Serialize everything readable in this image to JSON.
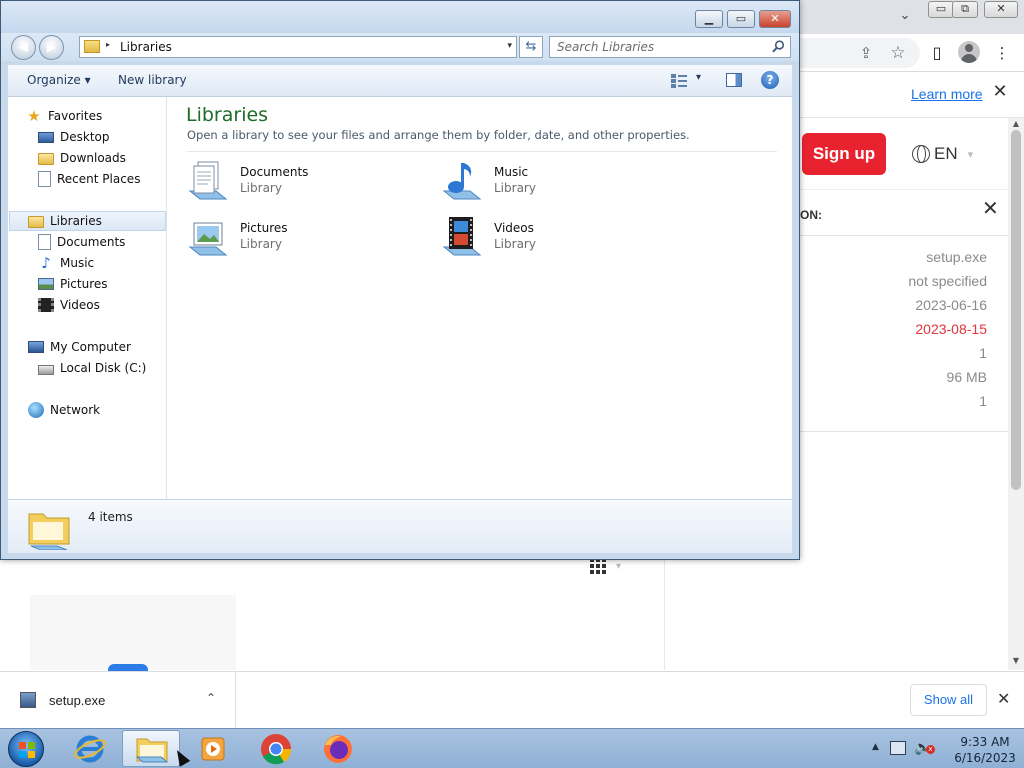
{
  "browser": {
    "window_controls": {
      "minimize": "▭",
      "restore": "⧉",
      "close": "✕"
    },
    "tab_dropdown": "⌄",
    "toolbar_icons": {
      "share": "⇪",
      "bookmark": "☆",
      "side_panel": "▯",
      "menu": "⋮"
    },
    "cookie_bar": {
      "learn_more": "Learn more",
      "close": "✕"
    },
    "header": {
      "signup_label": "Sign up",
      "language": "EN",
      "language_caret": "▾"
    },
    "info_panel": {
      "heading": "ON:",
      "close": "✕",
      "rows": [
        {
          "value": "setup.exe",
          "highlight": false
        },
        {
          "value": "not specified",
          "highlight": false
        },
        {
          "value": "2023-06-16",
          "highlight": false
        },
        {
          "value": "2023-08-15",
          "highlight": true
        },
        {
          "value": "1",
          "highlight": false
        },
        {
          "value": "96 MB",
          "highlight": false
        },
        {
          "value": "1",
          "highlight": false
        }
      ]
    },
    "scrollbar": {
      "up": "▲",
      "down": "▼"
    },
    "download_shelf": {
      "file_name": "setup.exe",
      "caret": "⌃",
      "show_all_label": "Show all",
      "close": "✕"
    },
    "colors": {
      "accent": "#1a73e8",
      "signup": "#e8232f",
      "date_highlight": "#e3343f"
    }
  },
  "explorer": {
    "caption_buttons": {
      "minimize": "▁",
      "maximize": "▭",
      "close": "✕"
    },
    "nav_buttons": {
      "back": "◀",
      "forward": "▶"
    },
    "address": {
      "path": "Libraries",
      "dropdown": "▾",
      "arrow": "▸"
    },
    "refresh": "⇆",
    "search": {
      "placeholder": "Search Libraries",
      "value": ""
    },
    "commands": {
      "organize": "Organize ▾",
      "new_library": "New library",
      "views_caret": "▾",
      "help": "?"
    },
    "nav": {
      "favorites": {
        "label": "Favorites",
        "icon": "star-icon"
      },
      "favorite_items": [
        {
          "label": "Desktop",
          "icon": "desktop-icon"
        },
        {
          "label": "Downloads",
          "icon": "downloads-icon"
        },
        {
          "label": "Recent Places",
          "icon": "recent-places-icon"
        }
      ],
      "libraries": {
        "label": "Libraries",
        "icon": "libraries-icon",
        "selected": true
      },
      "library_items": [
        {
          "label": "Documents",
          "icon": "documents-icon"
        },
        {
          "label": "Music",
          "icon": "music-icon"
        },
        {
          "label": "Pictures",
          "icon": "pictures-icon"
        },
        {
          "label": "Videos",
          "icon": "videos-icon"
        }
      ],
      "computer": {
        "label": "My Computer",
        "icon": "computer-icon"
      },
      "computer_items": [
        {
          "label": "Local Disk (C:)",
          "icon": "local-disk-icon"
        }
      ],
      "network": {
        "label": "Network",
        "icon": "network-icon"
      }
    },
    "content": {
      "title": "Libraries",
      "subtitle": "Open a library to see your files and arrange them by folder, date, and other properties.",
      "libraries": [
        {
          "name": "Documents",
          "kind": "Library",
          "icon": "documents-library-icon"
        },
        {
          "name": "Music",
          "kind": "Library",
          "icon": "music-library-icon"
        },
        {
          "name": "Pictures",
          "kind": "Library",
          "icon": "pictures-library-icon"
        },
        {
          "name": "Videos",
          "kind": "Library",
          "icon": "videos-library-icon"
        }
      ]
    },
    "details": {
      "item_count": "4 items"
    },
    "colors": {
      "title_green": "#1e6b2a",
      "frame": "#c9d9ec"
    }
  },
  "taskbar": {
    "apps": [
      {
        "name": "internet-explorer",
        "active": false
      },
      {
        "name": "windows-explorer",
        "active": true
      },
      {
        "name": "media-player",
        "active": false
      },
      {
        "name": "chrome",
        "active": false
      },
      {
        "name": "firefox",
        "active": false
      }
    ],
    "tray": {
      "arrow": "▲",
      "volume_icon": "🔈",
      "mute_mark": "x"
    },
    "clock": {
      "time": "9:33 AM",
      "date": "6/16/2023"
    }
  }
}
